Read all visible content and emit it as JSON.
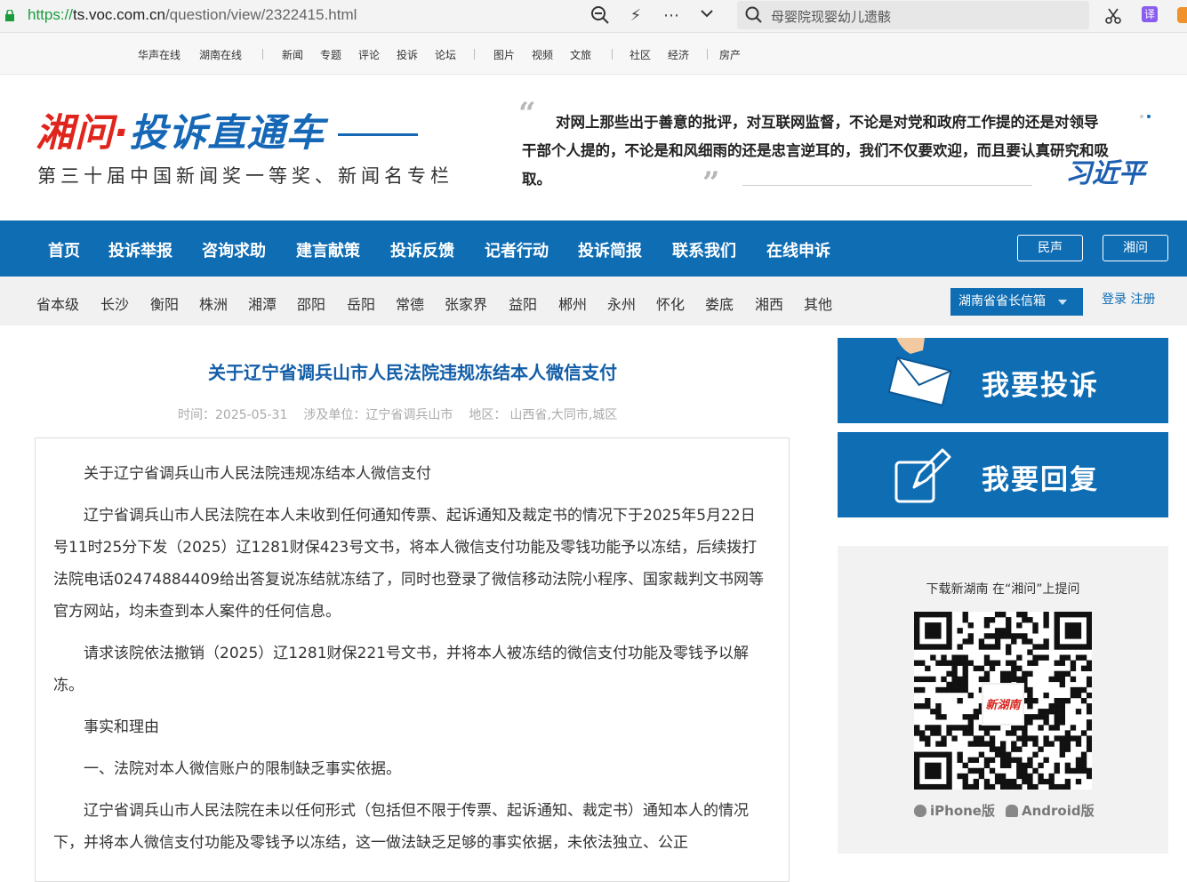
{
  "browser": {
    "url_protocol": "https://",
    "url_host": "ts.voc.com.cn",
    "url_path": "/question/view/2322415.html",
    "search_text": "母婴院现婴幼儿遗骸",
    "translate_label": "译"
  },
  "top_links": [
    "华声在线",
    "湖南在线",
    "新闻",
    "专题",
    "评论",
    "投诉",
    "论坛",
    "图片",
    "视频",
    "文旅",
    "社区",
    "经济",
    "房产"
  ],
  "header": {
    "logo_part1": "湘问·",
    "logo_part2": "投诉直通车",
    "logo_subtitle": "第三十届中国新闻奖一等奖、新闻名专栏",
    "quote_open": "“",
    "quote_close": "”",
    "quote_text": "对网上那些出于善意的批评，对互联网监督，不论是对党和政府工作提的还是对领导干部个人提的，不论是和风细雨的还是忠言逆耳的，我们不仅要欢迎，而且要认真研究和吸取。",
    "signature": "习近平"
  },
  "main_nav": {
    "items": [
      "首页",
      "投诉举报",
      "咨询求助",
      "建言献策",
      "投诉反馈",
      "记者行动",
      "投诉简报",
      "联系我们",
      "在线申诉"
    ],
    "btn1": "民声",
    "btn2": "湘问"
  },
  "city_nav": {
    "items": [
      "省本级",
      "长沙",
      "衡阳",
      "株洲",
      "湘潭",
      "邵阳",
      "岳阳",
      "常德",
      "张家界",
      "益阳",
      "郴州",
      "永州",
      "怀化",
      "娄底",
      "湘西",
      "其他"
    ],
    "mailbox": "湖南省省长信箱",
    "login": "登录 注册"
  },
  "article": {
    "title": "关于辽宁省调兵山市人民法院违规冻结本人微信支付",
    "time": "时间：2025-05-31",
    "unit": "涉及单位：辽宁省调兵山市",
    "region_label": "地区：",
    "region": "山西省,大同市,城区",
    "paragraphs": [
      "关于辽宁省调兵山市人民法院违规冻结本人微信支付",
      "辽宁省调兵山市人民法院在本人未收到任何通知传票、起诉通知及裁定书的情况下于2025年5月22日号11时25分下发（2025）辽1281财保423号文书，将本人微信支付功能及零钱功能予以冻结，后续拨打法院电话02474884409给出答复说冻结就冻结了，同时也登录了微信移动法院小程序、国家裁判文书网等官方网站，均未查到本人案件的任何信息。",
      "请求该院依法撤销（2025）辽1281财保221号文书，并将本人被冻结的微信支付功能及零钱予以解冻。",
      "事实和理由",
      "一、法院对本人微信账户的限制缺乏事实依据。",
      "辽宁省调兵山市人民法院在未以任何形式（包括但不限于传票、起诉通知、裁定书）通知本人的情况下，并将本人微信支付功能及零钱予以冻结，这一做法缺乏足够的事实依据，未依法独立、公正"
    ]
  },
  "sidebar": {
    "complain_label": "我要投诉",
    "reply_label": "我要回复",
    "qr_title": "下载新湖南 在“湘问”上提问",
    "qr_logo": "新湖南",
    "iphone": "iPhone版",
    "android": "Android版"
  },
  "colors": {
    "primary_blue": "#0f6db4",
    "logo_red": "#e0251c",
    "title_blue": "#135ea8"
  }
}
